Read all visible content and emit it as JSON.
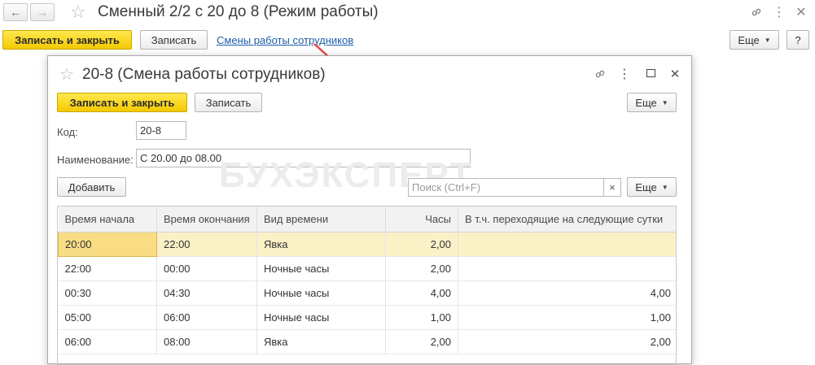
{
  "outer": {
    "title": "Сменный 2/2 с 20 до 8 (Режим работы)",
    "buttons": {
      "save_close": "Записать и закрыть",
      "save": "Записать",
      "more": "Еще",
      "help": "?"
    },
    "link": "Смены работы сотрудников"
  },
  "dialog": {
    "title": "20-8 (Смена работы сотрудников)",
    "buttons": {
      "save_close": "Записать и закрыть",
      "save": "Записать",
      "more": "Еще",
      "add": "Добавить",
      "table_more": "Еще"
    },
    "fields": {
      "code_label": "Код:",
      "code_value": "20-8",
      "name_label": "Наименование:",
      "name_value": "С 20.00 до 08.00"
    },
    "search": {
      "placeholder": "Поиск (Ctrl+F)",
      "clear": "×"
    },
    "watermark": "БУХЭКСПЕРТ",
    "table": {
      "columns": [
        "Время начала",
        "Время окончания",
        "Вид времени",
        "Часы",
        "В т.ч. переходящие на следующие сутки"
      ],
      "rows": [
        [
          "20:00",
          "22:00",
          "Явка",
          "2,00",
          ""
        ],
        [
          "22:00",
          "00:00",
          "Ночные часы",
          "2,00",
          ""
        ],
        [
          "00:30",
          "04:30",
          "Ночные часы",
          "4,00",
          "4,00"
        ],
        [
          "05:00",
          "06:00",
          "Ночные часы",
          "1,00",
          "1,00"
        ],
        [
          "06:00",
          "08:00",
          "Явка",
          "2,00",
          "2,00"
        ]
      ]
    }
  },
  "colors": {
    "accent_yellow": "#f5c900",
    "link_blue": "#1d5ea8",
    "selected_row": "#fbf1c7",
    "arrow_red": "#e8413b"
  }
}
